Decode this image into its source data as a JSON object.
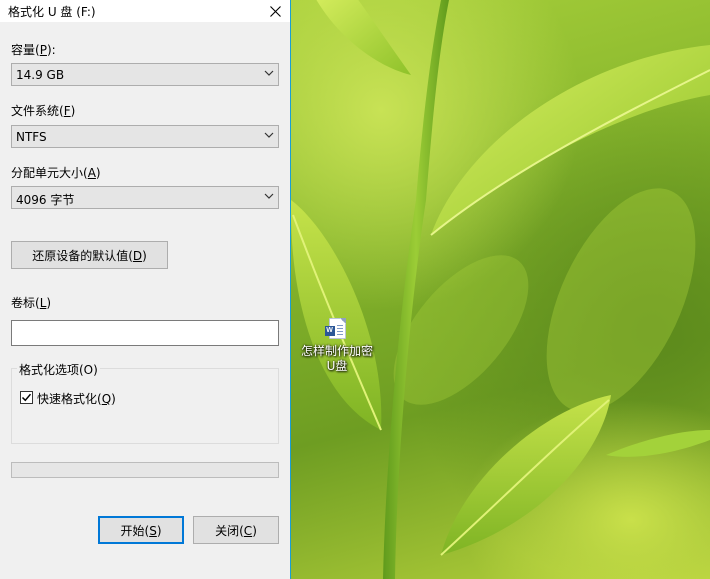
{
  "dialog": {
    "title": "格式化 U 盘 (F:)",
    "capacity": {
      "label": "容量(",
      "key": "P",
      "suffix": "):",
      "value": "14.9 GB"
    },
    "filesystem": {
      "label": "文件系统(",
      "key": "F",
      "suffix": ")",
      "value": "NTFS"
    },
    "allocation": {
      "label": "分配单元大小(",
      "key": "A",
      "suffix": ")",
      "value": "4096 字节"
    },
    "restore_button": {
      "label": "还原设备的默认值(",
      "key": "D",
      "suffix": ")"
    },
    "volume_label": {
      "label": "卷标(",
      "key": "L",
      "suffix": ")",
      "value": ""
    },
    "format_options": {
      "title": "格式化选项(O)",
      "quick_format": {
        "label": "快速格式化(",
        "key": "Q",
        "suffix": ")",
        "checked": true
      }
    },
    "progress": 0,
    "start_button": {
      "label": "开始(",
      "key": "S",
      "suffix": ")"
    },
    "close_button": {
      "label": "关闭(",
      "key": "C",
      "suffix": ")"
    }
  },
  "desktop": {
    "icon": {
      "label": "怎样制作加密U盘",
      "icon": "word-document-icon"
    }
  },
  "colors": {
    "accent": "#0078d7",
    "dialog_bg": "#f0f0f0",
    "window_border": "#1a9fd4"
  }
}
